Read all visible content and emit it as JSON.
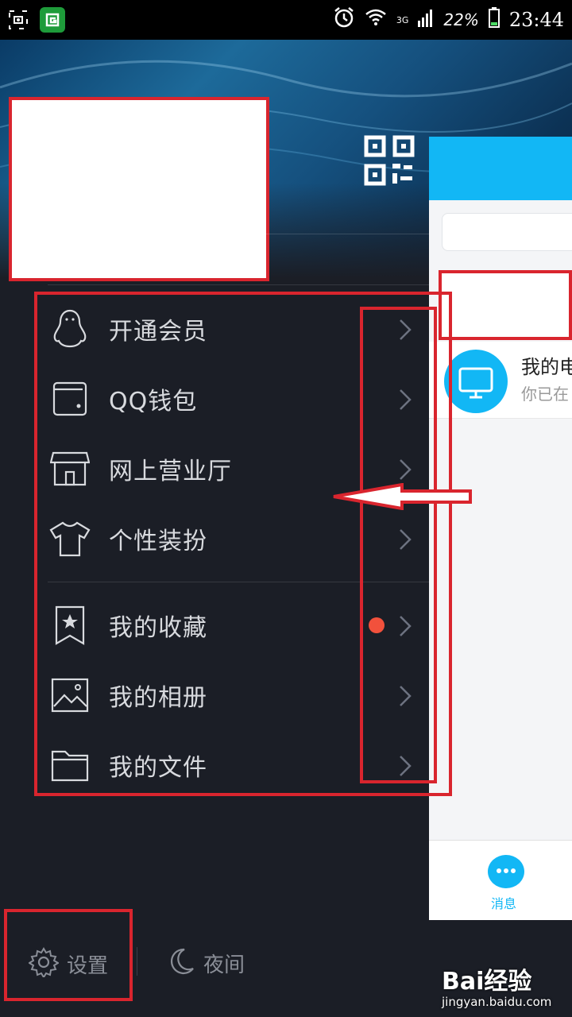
{
  "status_bar": {
    "network": "3G",
    "battery": "22%",
    "time": "23:44"
  },
  "menu": {
    "group1": [
      {
        "label": "开通会员",
        "icon": "penguin-icon"
      },
      {
        "label": "QQ钱包",
        "icon": "wallet-icon"
      },
      {
        "label": "网上营业厅",
        "icon": "store-icon"
      },
      {
        "label": "个性装扮",
        "icon": "tshirt-icon"
      }
    ],
    "group2": [
      {
        "label": "我的收藏",
        "icon": "bookmark-star-icon",
        "badge": true
      },
      {
        "label": "我的相册",
        "icon": "photo-icon"
      },
      {
        "label": "我的文件",
        "icon": "folder-icon"
      }
    ]
  },
  "bottom_bar": {
    "settings_label": "设置",
    "night_label": "夜间"
  },
  "peek_panel": {
    "contact_name": "我的电",
    "contact_sub": "你已在",
    "tab_label": "消息"
  },
  "watermark": {
    "brand": "Bai经验",
    "url": "jingyan.baidu.com"
  },
  "colors": {
    "accent": "#12b7f5",
    "badge": "#f2513c",
    "annotation": "#d9252e",
    "background": "#1b1e26"
  }
}
